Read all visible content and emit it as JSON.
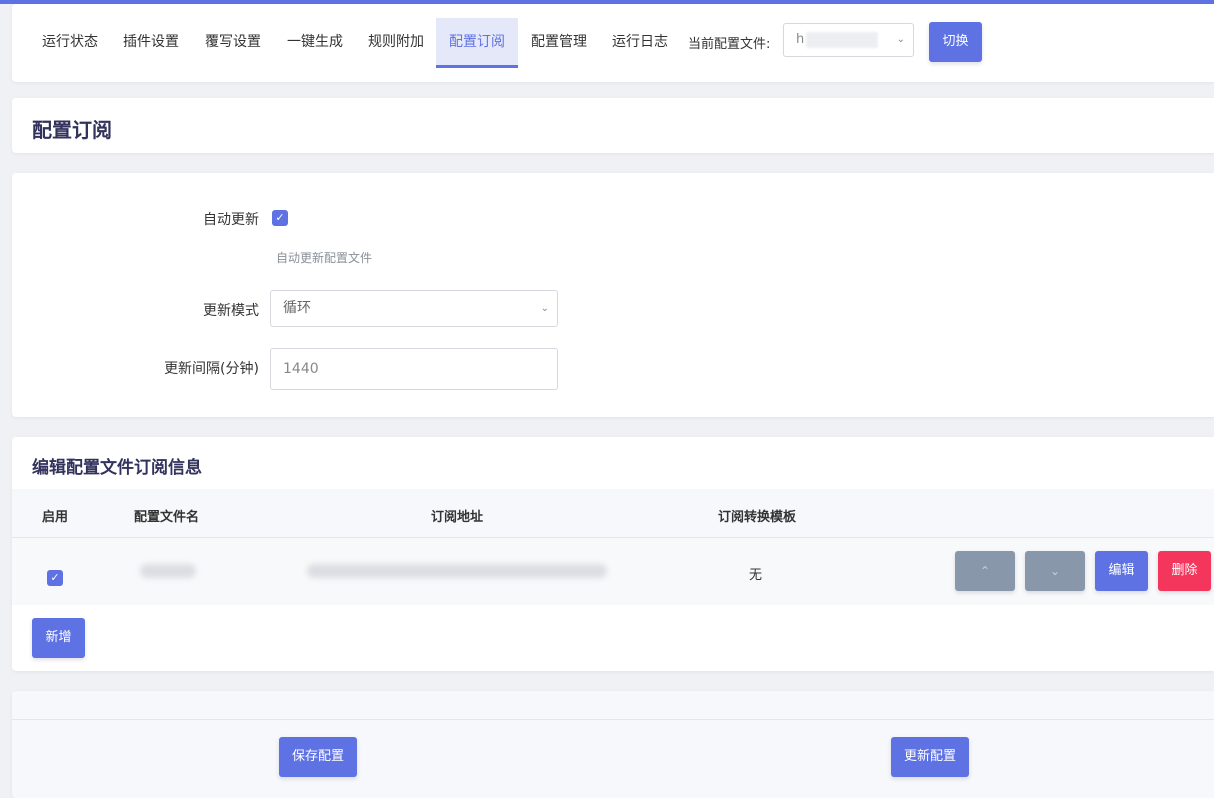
{
  "nav": {
    "tabs": [
      {
        "label": "运行状态",
        "active": false
      },
      {
        "label": "插件设置",
        "active": false
      },
      {
        "label": "覆写设置",
        "active": false
      },
      {
        "label": "一键生成",
        "active": false
      },
      {
        "label": "规则附加",
        "active": false
      },
      {
        "label": "配置订阅",
        "active": true
      },
      {
        "label": "配置管理",
        "active": false
      },
      {
        "label": "运行日志",
        "active": false
      }
    ],
    "config_label": "当前配置文件:",
    "config_value": "h",
    "switch_label": "切换"
  },
  "page": {
    "title": "配置订阅"
  },
  "form": {
    "auto_update_label": "自动更新",
    "auto_update_checked": true,
    "auto_update_hint": "自动更新配置文件",
    "mode_label": "更新模式",
    "mode_value": "循环",
    "interval_label": "更新间隔(分钟)",
    "interval_placeholder": "1440"
  },
  "subs": {
    "title": "编辑配置文件订阅信息",
    "columns": [
      "启用",
      "配置文件名",
      "订阅地址",
      "订阅转换模板"
    ],
    "rows": [
      {
        "enabled": true,
        "template": "无"
      }
    ],
    "up_icon": "chevron-up-icon",
    "down_icon": "chevron-down-icon",
    "edit_label": "编辑",
    "delete_label": "删除",
    "add_label": "新增"
  },
  "footer": {
    "save_label": "保存配置",
    "update_label": "更新配置"
  },
  "colors": {
    "primary": "#5e72e4",
    "danger": "#f5365c",
    "secondary": "#8898aa"
  }
}
